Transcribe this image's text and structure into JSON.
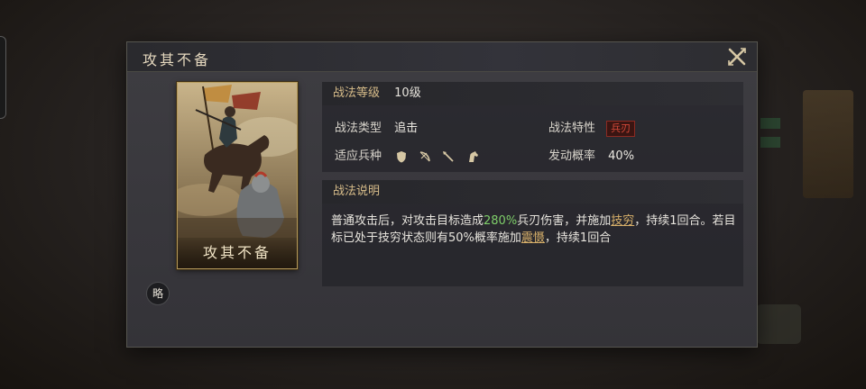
{
  "colors": {
    "accent_gold": "#d8bd8a",
    "trait_red": "#d84a3a",
    "highlight_green": "#7fcf6a",
    "link_gold": "#d8b06a"
  },
  "dialog": {
    "title": "攻其不备",
    "close_icon": "close-x-icon"
  },
  "card": {
    "name": "攻其不备",
    "art": "mounted-general-battle-art"
  },
  "brief_badge": "略",
  "tactic": {
    "level_label": "战法等级",
    "level_value": "10级",
    "type_label": "战法类型",
    "type_value": "追击",
    "trait_label": "战法特性",
    "trait_value": "兵刃",
    "troops_label": "适应兵种",
    "troops": [
      "shield-icon",
      "bow-icon",
      "spear-icon",
      "horse-icon"
    ],
    "rate_label": "发动概率",
    "rate_value": "40%"
  },
  "description": {
    "header": "战法说明",
    "p1": "普通攻击后，对攻击目标造成",
    "dmg": "280%",
    "p2": "兵刃伤害，并施加",
    "status1": "技穷",
    "p3": "，持续1回合。若目标已处于技穷状态则有50%概率施加",
    "status2": "震慑",
    "p4": "，持续1回合"
  }
}
